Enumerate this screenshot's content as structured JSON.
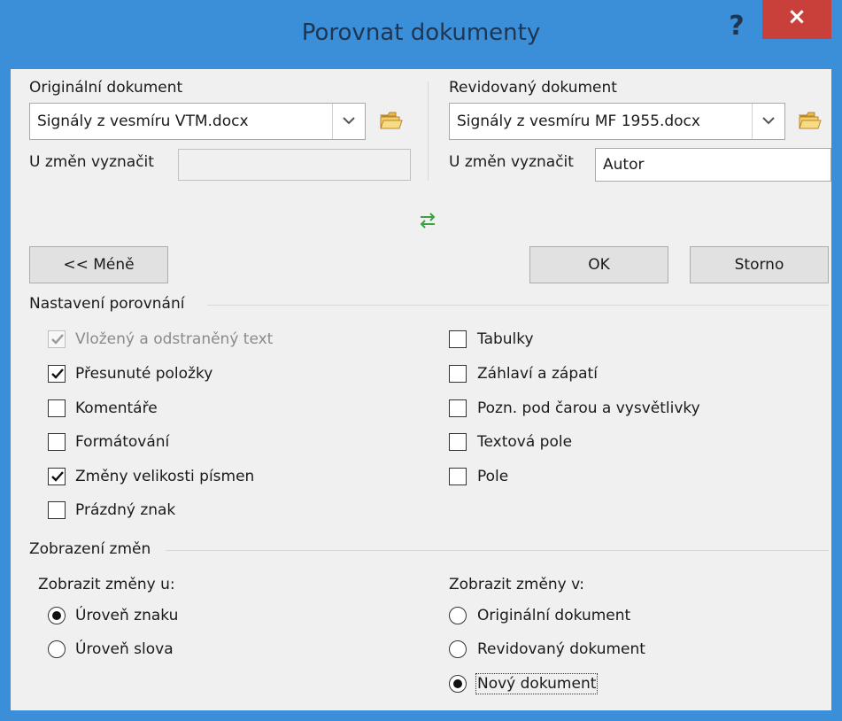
{
  "dialog": {
    "title": "Porovnat dokumenty",
    "help_icon": "?",
    "close_icon": "×"
  },
  "original": {
    "label": "Originální dokument",
    "file": "Signály z vesmíru VTM.docx",
    "mark_label": "U změn vyznačit",
    "mark_value": ""
  },
  "revised": {
    "label": "Revidovaný dokument",
    "file": "Signály z vesmíru MF 1955.docx",
    "mark_label": "U změn vyznačit",
    "mark_value": "Autor"
  },
  "buttons": {
    "less": "<< Méně",
    "ok": "OK",
    "cancel": "Storno"
  },
  "compare_settings": {
    "title": "Nastavení porovnání",
    "left": [
      {
        "label": "Vložený a odstraněný text",
        "checked": true,
        "disabled": true
      },
      {
        "label": "Přesunuté položky",
        "checked": true
      },
      {
        "label": "Komentáře",
        "checked": false
      },
      {
        "label": "Formátování",
        "checked": false
      },
      {
        "label": "Změny velikosti písmen",
        "checked": true
      },
      {
        "label": "Prázdný znak",
        "checked": false
      }
    ],
    "right": [
      {
        "label": "Tabulky",
        "checked": false
      },
      {
        "label": "Záhlaví a zápatí",
        "checked": false
      },
      {
        "label": "Pozn. pod čarou a vysvětlivky",
        "checked": false
      },
      {
        "label": "Textová pole",
        "checked": false
      },
      {
        "label": "Pole",
        "checked": false
      }
    ]
  },
  "show_changes": {
    "title": "Zobrazení změn",
    "at_label": "Zobrazit změny u:",
    "at_options": [
      {
        "label": "Úroveň znaku",
        "selected": true
      },
      {
        "label": "Úroveň slova",
        "selected": false
      }
    ],
    "in_label": "Zobrazit změny v:",
    "in_options": [
      {
        "label": "Originální dokument",
        "selected": false
      },
      {
        "label": "Revidovaný dokument",
        "selected": false
      },
      {
        "label": "Nový dokument",
        "selected": true
      }
    ]
  },
  "colors": {
    "titlebar": "#3b8fd9",
    "close": "#c9403a",
    "swap_icon": "#3aa340"
  }
}
